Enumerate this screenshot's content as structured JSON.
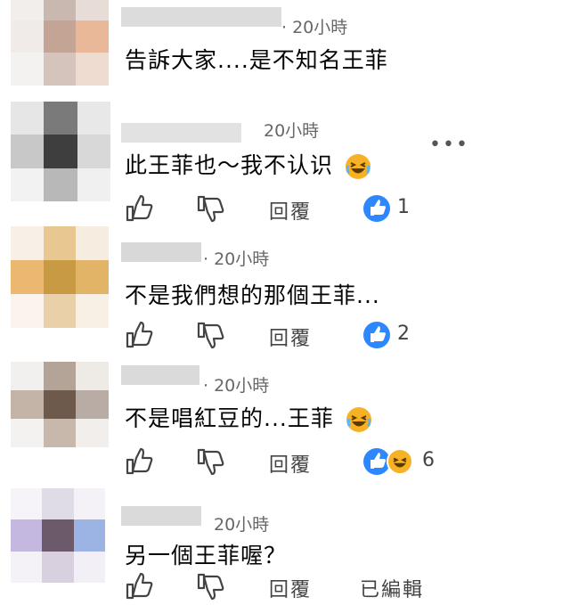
{
  "comments": [
    {
      "time": "· 20小時",
      "text": "告訴大家....是不知名王菲",
      "has_emoji": false
    },
    {
      "time": "20小時",
      "text": "此王菲也～我不认识",
      "has_emoji": true,
      "reply_label": "回覆",
      "reaction_count": "1"
    },
    {
      "time": "· 20小時",
      "text": "不是我們想的那個王菲...",
      "has_emoji": false,
      "reply_label": "回覆",
      "reaction_count": "2"
    },
    {
      "time": "· 20小時",
      "text": "不是唱紅豆的...王菲",
      "has_emoji": true,
      "reply_label": "回覆",
      "reaction_count": "6"
    },
    {
      "time": "20小時",
      "text": "另一個王菲喔？",
      "has_emoji": false,
      "reply_label": "回覆",
      "edited_label": "已編輯"
    }
  ],
  "more_menu": "•••",
  "colors": {
    "like_blue": "#2d88ff",
    "haha_yellow": "#f7b125",
    "meta_gray": "#65676b"
  },
  "icons": [
    "thumbs-up-icon",
    "thumbs-down-icon",
    "like-reaction-icon",
    "haha-reaction-icon",
    "more-options-icon"
  ]
}
